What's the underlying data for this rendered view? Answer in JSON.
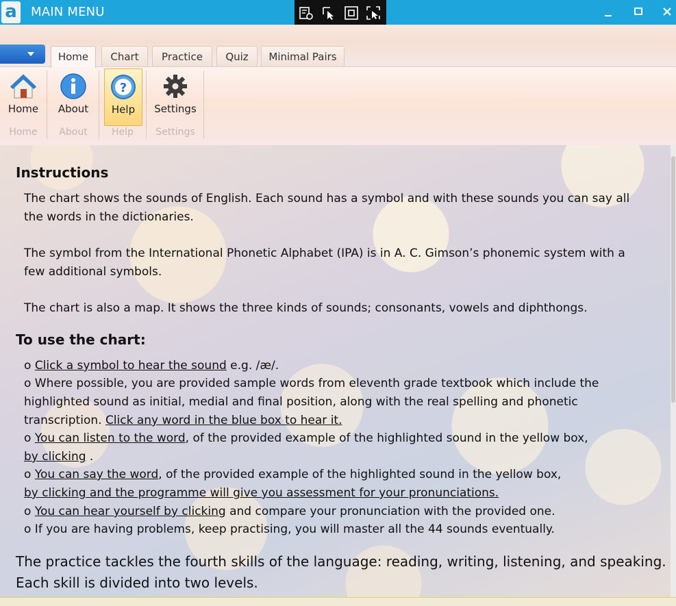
{
  "window": {
    "title": "MAIN MENU",
    "logo_letter": "a"
  },
  "ribbon": {
    "tabs": [
      "Home",
      "Chart",
      "Practice",
      "Quiz",
      "Minimal Pairs"
    ],
    "buttons": [
      {
        "label": "Home",
        "group": "Home"
      },
      {
        "label": "About",
        "group": "About"
      },
      {
        "label": "Help",
        "group": "Help"
      },
      {
        "label": "Settings",
        "group": "Settings"
      }
    ]
  },
  "instructions": {
    "heading": "Instructions",
    "para1_line1": "The chart shows the sounds of English. Each sound has a symbol and with these sounds you can say all",
    "para1_line2": "the words in the dictionaries.",
    "para2_line1": "The symbol from the International Phonetic Alphabet (IPA) is in A. C. Gimson’s phonemic system with a",
    "para2_line2": "few additional symbols.",
    "para3": "The chart is also a map. It shows the three kinds of sounds; consonants, vowels and diphthongs."
  },
  "use_chart": {
    "heading": "To use the chart:",
    "b1_prefix": "o ",
    "b1_link": "Click a symbol to hear the sound",
    "b1_suffix": " e.g. /æ/.",
    "b2_line1": "o Where possible, you are provided sample words from eleventh grade textbook which include the",
    "b2_line2": "highlighted sound as initial, medial and final position, along with the real spelling and phonetic",
    "b2_line3_prefix": "transcription. ",
    "b2_line3_link": "Click any word in the blue box to hear it.",
    "b3_prefix": "o ",
    "b3_link": "You can listen to the word",
    "b3_suffix": ", of the provided example of the highlighted sound in the yellow box,",
    "b3_line2_link": "by clicking",
    "b3_line2_suffix": " .",
    "b4_prefix": "o ",
    "b4_link": "You can say the word",
    "b4_suffix": ", of the provided example of the highlighted sound in the yellow box,",
    "b4_line2_link": "by clicking and the programme will give you assessment for your pronunciations.",
    "b5_prefix": "o ",
    "b5_link": "You can hear yourself by clicking",
    "b5_suffix": " and compare your pronunciation with the provided one.",
    "b6": "o If you are having problems, keep practising, you will master all the 44 sounds eventually."
  },
  "practice": {
    "line1": "The practice tackles the fourth skills of the language: reading, writing, listening, and speaking.",
    "line2": "Each skill is divided into two levels."
  },
  "colors": {
    "titlebar": "#1ea5dc",
    "ribbon_highlight": "#fbd67a",
    "text": "#111111"
  }
}
